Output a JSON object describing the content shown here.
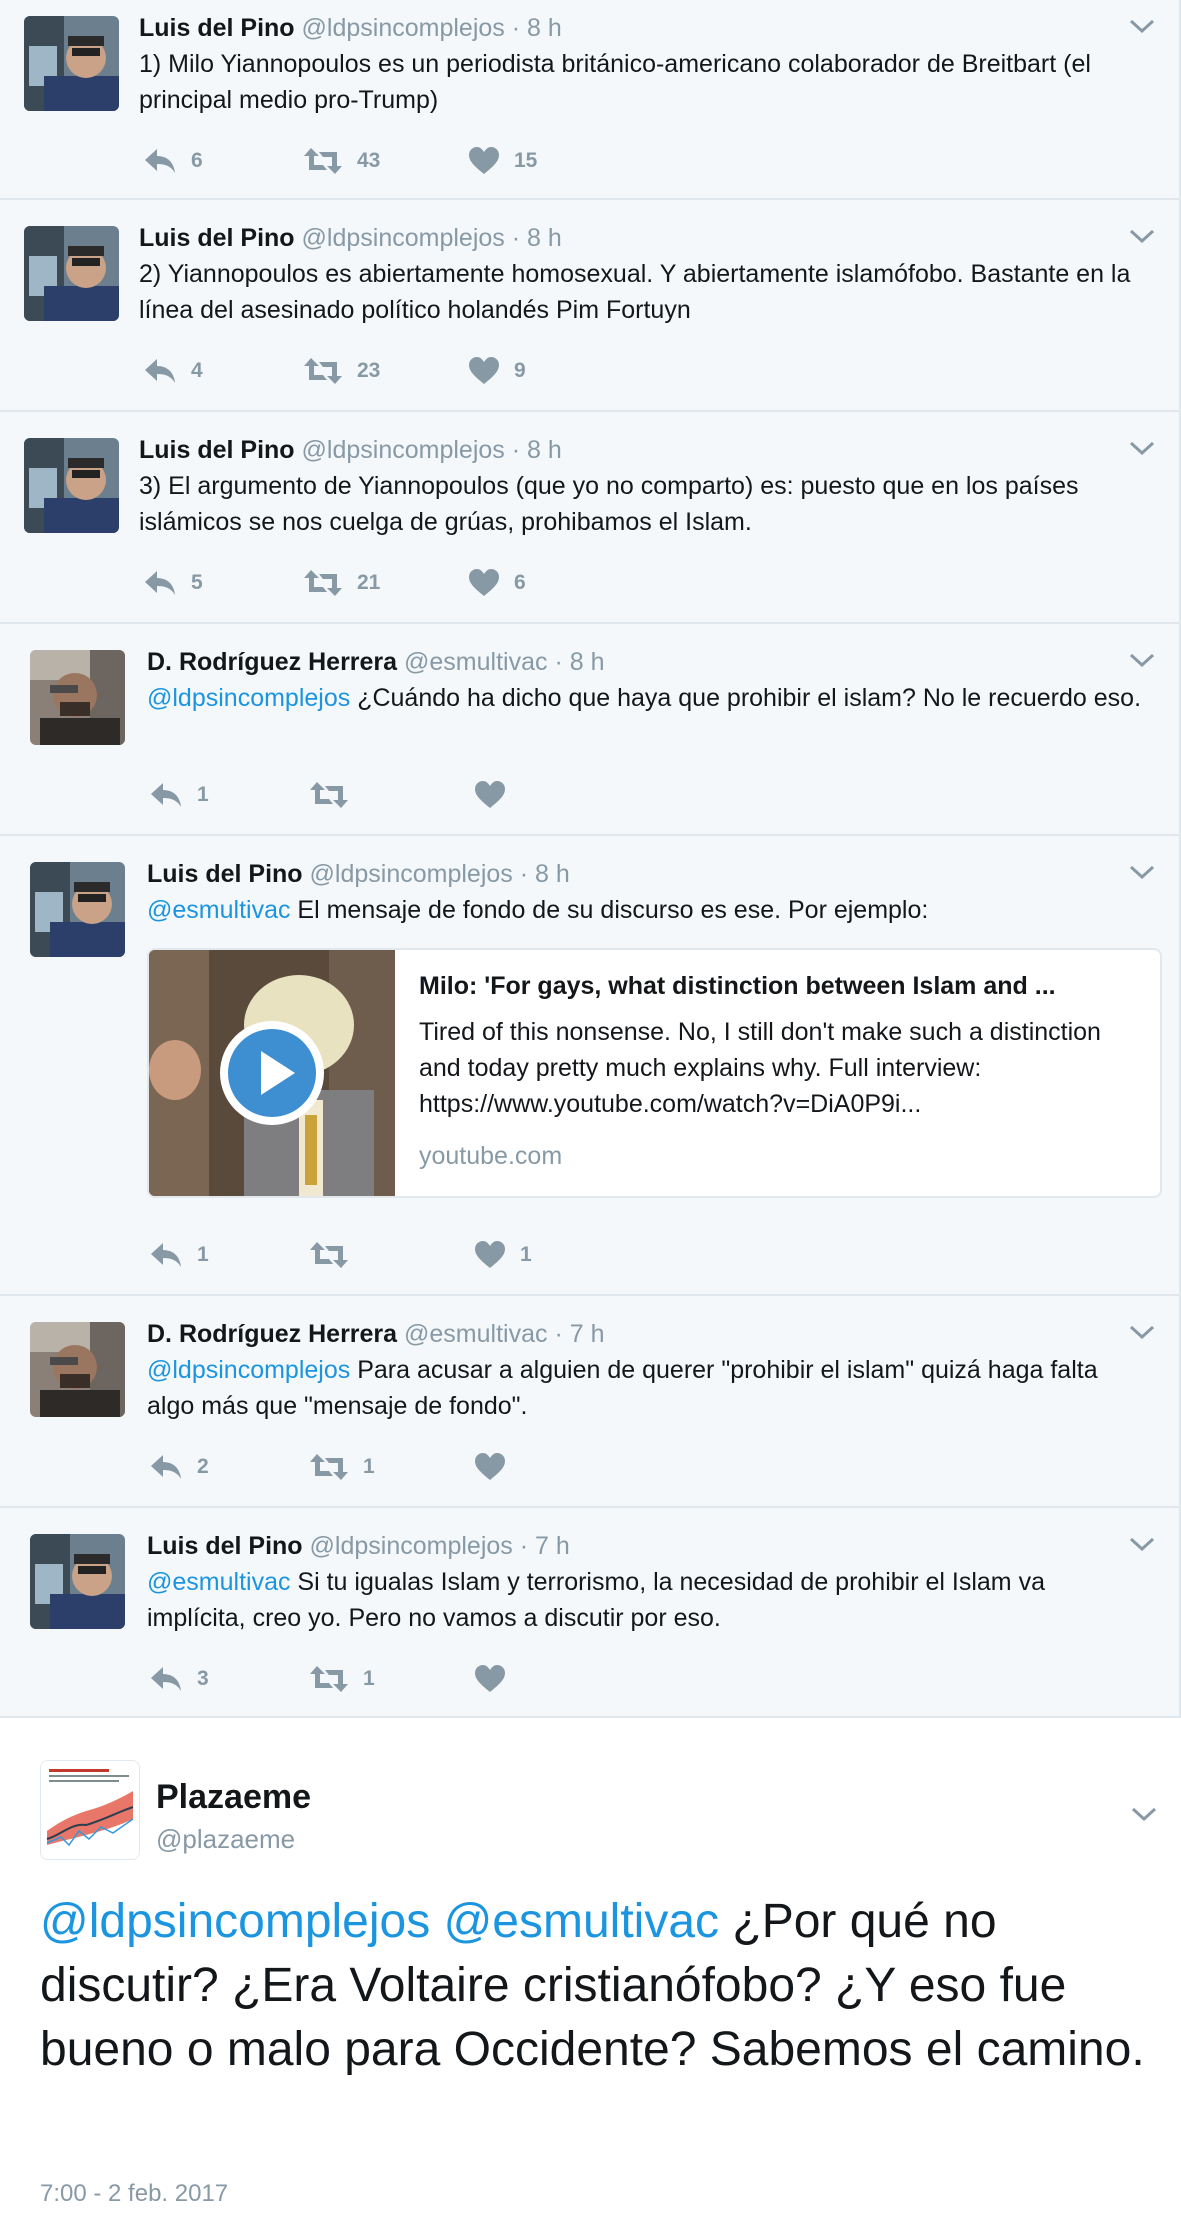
{
  "thread": [
    {
      "name": "Luis del Pino",
      "handle": "@ldpsincomplejos",
      "sep": "·",
      "time": "8 h",
      "mention": "",
      "text": "1) Milo Yiannopoulos es un periodista británico-americano colaborador de Breitbart (el principal medio pro-Trump)",
      "reply_count": "6",
      "retweet_count": "43",
      "like_count": "15"
    },
    {
      "name": "Luis del Pino",
      "handle": "@ldpsincomplejos",
      "sep": "·",
      "time": "8 h",
      "mention": "",
      "text": "2) Yiannopoulos es abiertamente homosexual. Y abiertamente islamófobo. Bastante en la línea del asesinado político holandés Pim Fortuyn",
      "reply_count": "4",
      "retweet_count": "23",
      "like_count": "9"
    },
    {
      "name": "Luis del Pino",
      "handle": "@ldpsincomplejos",
      "sep": "·",
      "time": "8 h",
      "mention": "",
      "text": "3) El argumento de Yiannopoulos (que yo no comparto) es: puesto que en los países islámicos se nos cuelga de grúas, prohibamos el Islam.",
      "reply_count": "5",
      "retweet_count": "21",
      "like_count": "6"
    },
    {
      "name": "D. Rodríguez Herrera",
      "handle": "@esmultivac",
      "sep": "·",
      "time": "8 h",
      "mention": "@ldpsincomplejos",
      "text": " ¿Cuándo ha dicho que haya que prohibir el islam? No le recuerdo eso.",
      "reply_count": "1",
      "retweet_count": "",
      "like_count": ""
    },
    {
      "name": "Luis del Pino",
      "handle": "@ldpsincomplejos",
      "sep": "·",
      "time": "8 h",
      "mention": "@esmultivac",
      "text": " El mensaje de fondo de su discurso es ese. Por ejemplo:",
      "reply_count": "1",
      "retweet_count": "",
      "like_count": "1",
      "card": {
        "title": "Milo: 'For gays, what distinction between Islam and ...",
        "description": "Tired of this nonsense. No, I still don't make such a distinction and today pretty much explains why. Full interview: https://www.youtube.com/watch?v=DiA0P9i...",
        "domain": "youtube.com"
      }
    },
    {
      "name": "D. Rodríguez Herrera",
      "handle": "@esmultivac",
      "sep": "·",
      "time": "7 h",
      "mention": "@ldpsincomplejos",
      "text": " Para acusar a alguien de querer \"prohibir el islam\" quizá haga falta algo más que \"mensaje de fondo\".",
      "reply_count": "2",
      "retweet_count": "1",
      "like_count": ""
    },
    {
      "name": "Luis del Pino",
      "handle": "@ldpsincomplejos",
      "sep": "·",
      "time": "7 h",
      "mention": "@esmultivac",
      "text": " Si tu igualas Islam y terrorismo, la necesidad de prohibir el Islam va implícita, creo yo. Pero no vamos a discutir por eso.",
      "reply_count": "3",
      "retweet_count": "1",
      "like_count": ""
    }
  ],
  "main": {
    "name": "Plazaeme",
    "handle": "@plazaeme",
    "mention1": "@ldpsincomplejos",
    "mention2": "@esmultivac",
    "text": " ¿Por qué no discutir? ¿Era Voltaire cristianófobo? ¿Y eso fue bueno o malo para Occidente? Sabemos el camino.",
    "date": "7:00 - 2 feb. 2017"
  },
  "colors": {
    "link": "#1b95e0",
    "muted": "#8899a6",
    "thread_bg": "#f5f8fa",
    "border": "#e1e8ed"
  }
}
